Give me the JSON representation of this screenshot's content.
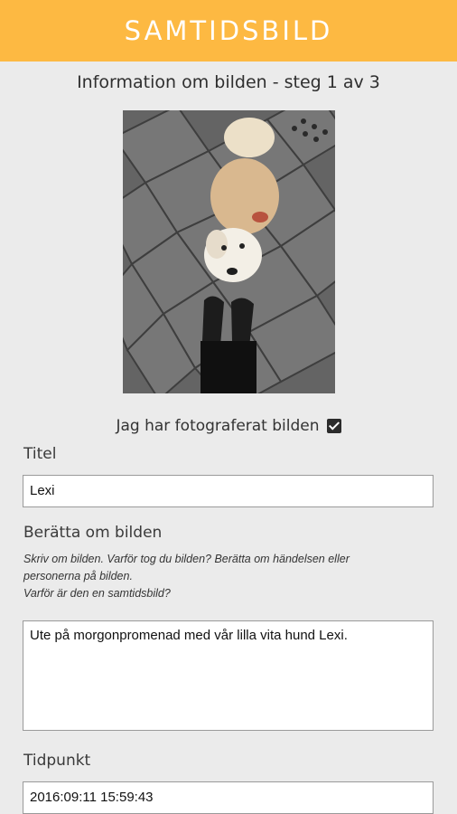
{
  "header": {
    "title": "SAMTIDSBILD"
  },
  "step_title": "Information om bilden - steg 1 av 3",
  "photo": {
    "subject": "dog-photo"
  },
  "own_photo": {
    "label": "Jag har fotograferat bilden",
    "checked": true
  },
  "title_field": {
    "label": "Titel",
    "value": "Lexi"
  },
  "story": {
    "label": "Berätta om bilden",
    "hint_lines": [
      "Skriv om bilden. Varför tog du bilden? Berätta om händelsen eller",
      "personerna på bilden.",
      "Varför är den en samtidsbild?"
    ],
    "value": "Ute på morgonpromenad med vår lilla vita hund Lexi."
  },
  "time_field": {
    "label": "Tidpunkt",
    "value": "2016:09:11 15:59:43"
  },
  "colors": {
    "header_bg": "#fdb942",
    "page_bg": "#ebebeb"
  }
}
